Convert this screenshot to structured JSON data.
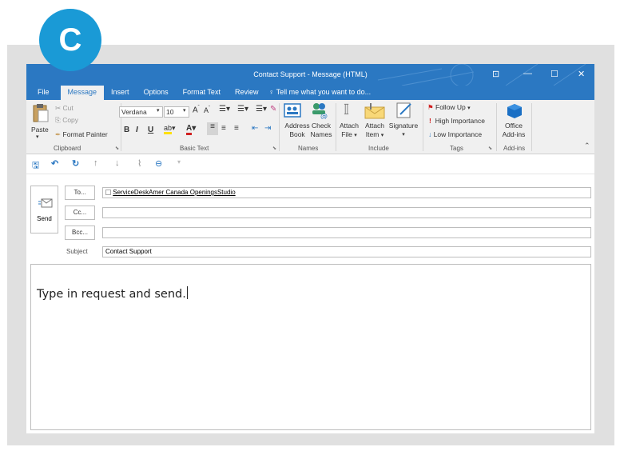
{
  "badge": "C",
  "window": {
    "title": "Contact Support - Message (HTML)",
    "controls": [
      "restore-ribbon-icon",
      "minimize-icon",
      "maximize-icon",
      "close-icon"
    ],
    "accent_color": "#2b78c2"
  },
  "tabs": [
    {
      "label": "File"
    },
    {
      "label": "Message",
      "active": true
    },
    {
      "label": "Insert"
    },
    {
      "label": "Options"
    },
    {
      "label": "Format Text"
    },
    {
      "label": "Review"
    }
  ],
  "tell_me": "Tell me what you want to do...",
  "ribbon": {
    "clipboard": {
      "paste": "Paste",
      "cut": "Cut",
      "copy": "Copy",
      "format_painter": "Format Painter",
      "label": "Clipboard"
    },
    "basic_text": {
      "font": "Verdana",
      "size": "10",
      "label": "Basic Text"
    },
    "names": {
      "address_book_1": "Address",
      "address_book_2": "Book",
      "check_names_1": "Check",
      "check_names_2": "Names",
      "label": "Names"
    },
    "include": {
      "attach_file_1": "Attach",
      "attach_file_2": "File",
      "attach_item_1": "Attach",
      "attach_item_2": "Item",
      "signature": "Signature",
      "label": "Include"
    },
    "tags": {
      "follow_up": "Follow Up",
      "high": "High Importance",
      "low": "Low Importance",
      "label": "Tags"
    },
    "addins": {
      "office_1": "Office",
      "office_2": "Add-ins",
      "label": "Add-ins"
    }
  },
  "compose": {
    "send": "Send",
    "to_label": "To...",
    "to_value": "ServiceDeskAmer Canada OpeningsStudio",
    "cc_label": "Cc...",
    "bcc_label": "Bcc...",
    "subject_label": "Subject",
    "subject_value": "Contact Support",
    "body": "Type in request and send."
  }
}
